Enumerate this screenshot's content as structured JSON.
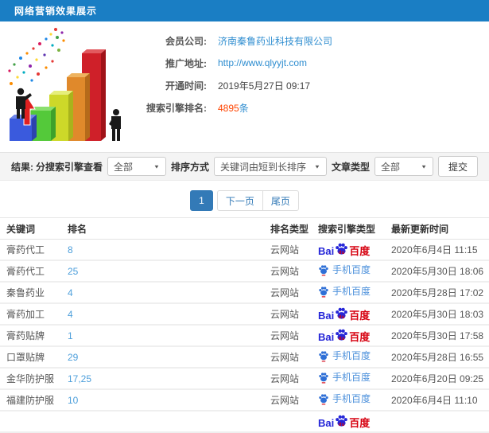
{
  "window": {
    "title": "网络营销效果展示"
  },
  "info": {
    "company_label": "会员公司:",
    "company_value": "济南秦鲁药业科技有限公司",
    "url_label": "推广地址:",
    "url_value": "http://www.qlyyjt.com",
    "opened_label": "开通时间:",
    "opened_value": "2019年5月27日 09:17",
    "rank_label": "搜索引擎排名:",
    "rank_count": "4895",
    "rank_unit": "条"
  },
  "filter": {
    "results_label": "结果:",
    "engine_label": "分搜索引擎查看",
    "engine_value": "全部",
    "sort_label": "排序方式",
    "sort_value": "关键词由短到长排序",
    "article_label": "文章类型",
    "article_value": "全部",
    "submit_label": "提交"
  },
  "pagination": {
    "current": "1",
    "next": "下一页",
    "last": "尾页"
  },
  "table": {
    "columns": [
      "关键词",
      "排名",
      "排名类型",
      "搜索引擎类型",
      "最新更新时间"
    ],
    "baidu_logo": {
      "bai": "Bai",
      "du": "du",
      "cn": "百度"
    },
    "mobile_label": "手机百度",
    "rows": [
      {
        "keyword": "膏药代工",
        "rank": "8",
        "rank_type": "云网站",
        "engine": "baidu",
        "updated": "2020年6月4日 11:15"
      },
      {
        "keyword": "膏药代工",
        "rank": "25",
        "rank_type": "云网站",
        "engine": "shouji-baidu",
        "updated": "2020年5月30日 18:06"
      },
      {
        "keyword": "秦鲁药业",
        "rank": "4",
        "rank_type": "云网站",
        "engine": "shouji-baidu",
        "updated": "2020年5月28日 17:02"
      },
      {
        "keyword": "膏药加工",
        "rank": "4",
        "rank_type": "云网站",
        "engine": "baidu",
        "updated": "2020年5月30日 18:03"
      },
      {
        "keyword": "膏药贴牌",
        "rank": "1",
        "rank_type": "云网站",
        "engine": "baidu",
        "updated": "2020年5月30日 17:58"
      },
      {
        "keyword": "口罩贴牌",
        "rank": "29",
        "rank_type": "云网站",
        "engine": "shouji-baidu",
        "updated": "2020年5月28日 16:55"
      },
      {
        "keyword": "金华防护服",
        "rank": "17,25",
        "rank_type": "云网站",
        "engine": "shouji-baidu",
        "updated": "2020年6月20日 09:25"
      },
      {
        "keyword": "福建防护服",
        "rank": "10",
        "rank_type": "云网站",
        "engine": "shouji-baidu",
        "updated": "2020年6月4日 11:10"
      },
      {
        "keyword": "",
        "rank": "",
        "rank_type": "",
        "engine": "baidu",
        "updated": ""
      }
    ]
  },
  "colors": {
    "topbar_blue": "#1a7ec4",
    "link_blue": "#2e8dd0",
    "rank_link_blue": "#4d9fdb",
    "highlight_red": "#ff4400",
    "pagination_blue": "#337ab7",
    "baidu_blue": "#2526d8",
    "baidu_red": "#d6000f"
  }
}
